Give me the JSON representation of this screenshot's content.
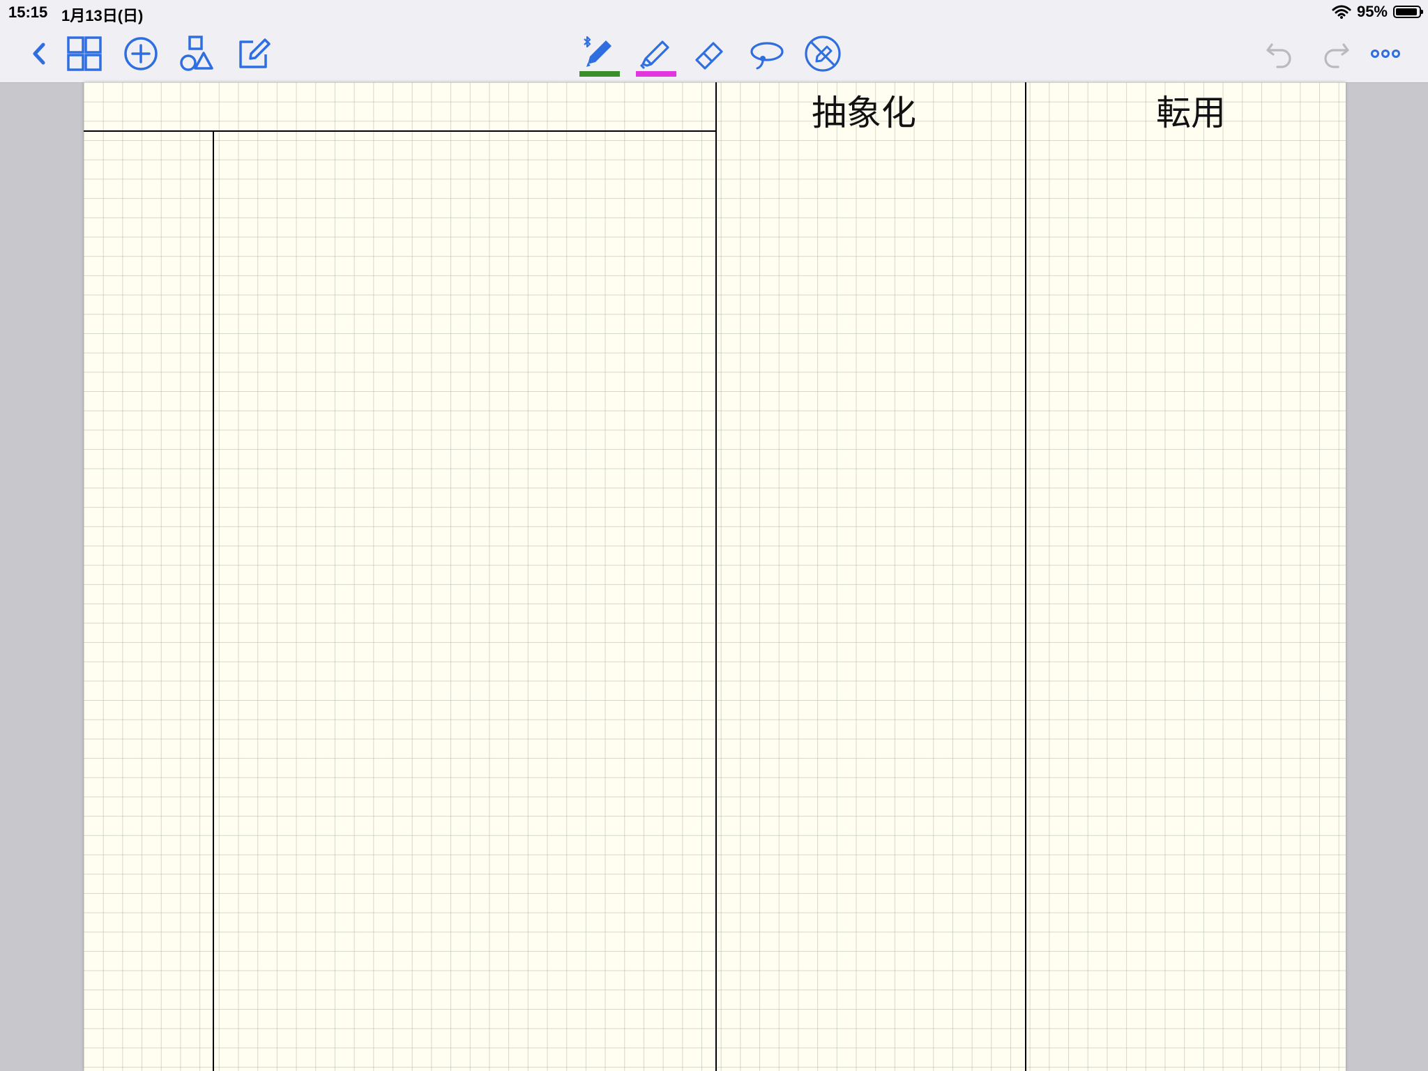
{
  "status_bar": {
    "time": "15:15",
    "date": "1月13日(日)",
    "battery": "95%",
    "battery_level": 0.95,
    "icons": [
      "wifi-icon",
      "battery-icon"
    ]
  },
  "toolbar": {
    "left_icons": [
      "back-chevron-icon",
      "thumbnail-grid-icon",
      "add-page-icon",
      "shapes-icon",
      "edit-document-icon"
    ],
    "tools": [
      {
        "name": "pen-tool",
        "icon": "bluetooth-pen-icon",
        "color": "#3b8e2c",
        "selected": true
      },
      {
        "name": "highlighter-tool",
        "icon": "highlighter-icon",
        "color": "#e236e0"
      },
      {
        "name": "eraser-tool",
        "icon": "eraser-icon"
      },
      {
        "name": "lasso-tool",
        "icon": "lasso-icon"
      },
      {
        "name": "disable-pen-tool",
        "icon": "pen-off-icon"
      }
    ],
    "right_icons": [
      "undo-icon",
      "redo-icon",
      "more-options-icon"
    ],
    "accent_color": "#2f6ee0",
    "disabled_color": "#b9b9be"
  },
  "page": {
    "paper_color": "#fffef0",
    "grid_color": "#a0aaa0",
    "headers": {
      "abstraction": "抽象化",
      "transfer": "転用"
    }
  }
}
